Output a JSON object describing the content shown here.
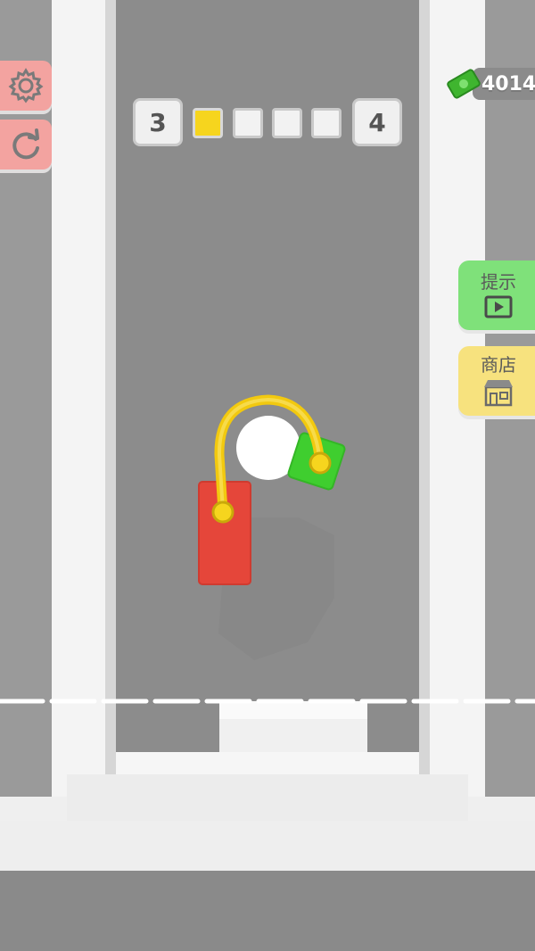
{
  "progress": {
    "current_level": "3",
    "next_level": "4",
    "steps": [
      true,
      false,
      false,
      false
    ]
  },
  "currency": {
    "amount": "4014",
    "icon": "cash-icon"
  },
  "left_buttons": [
    {
      "name": "settings",
      "icon": "gear-icon"
    },
    {
      "name": "restart",
      "icon": "restart-icon"
    }
  ],
  "right_buttons": {
    "hint_label": "提示",
    "hint_icon": "video-play-icon",
    "shop_label": "商店",
    "shop_icon": "store-icon"
  },
  "colors": {
    "hint_bg": "#7fe17a",
    "shop_bg": "#f7e27e",
    "red_block": "#e5463a",
    "green_block": "#3fce2f",
    "rope": "#f6d51e"
  }
}
